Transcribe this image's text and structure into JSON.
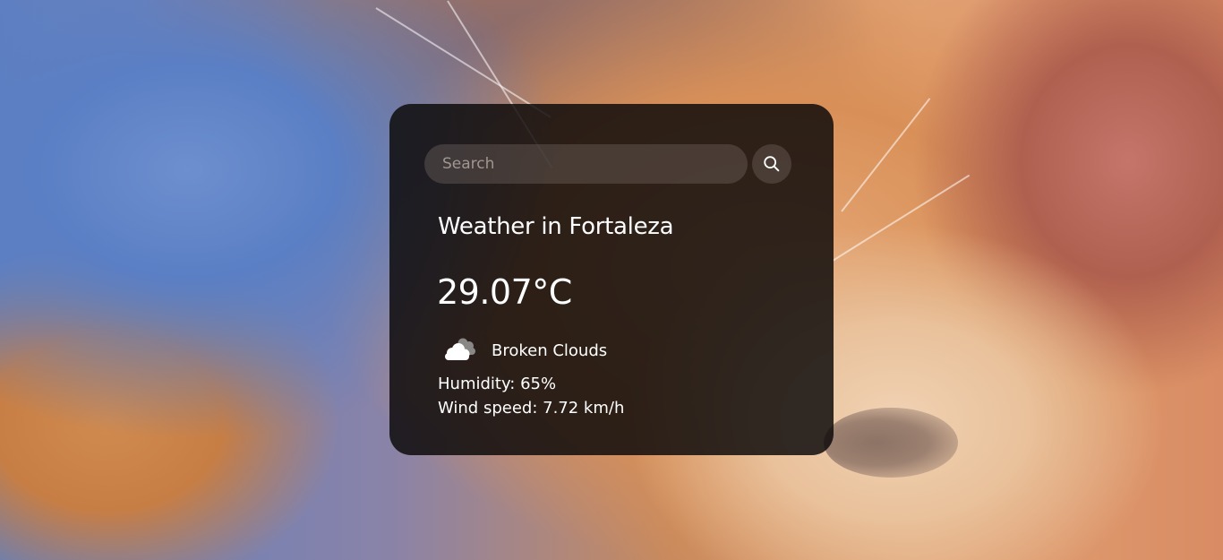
{
  "search": {
    "placeholder": "Search",
    "value": "",
    "button_icon": "search-icon"
  },
  "weather": {
    "title": "Weather in Fortaleza",
    "temperature": "29.07°C",
    "condition_icon": "broken-clouds-icon",
    "description": "Broken Clouds",
    "humidity": "Humidity: 65%",
    "wind_speed": "Wind speed: 7.72 km/h"
  },
  "colors": {
    "card_background": "#0c0a0a",
    "text": "#ffffff",
    "search_field": "#7d736e"
  }
}
